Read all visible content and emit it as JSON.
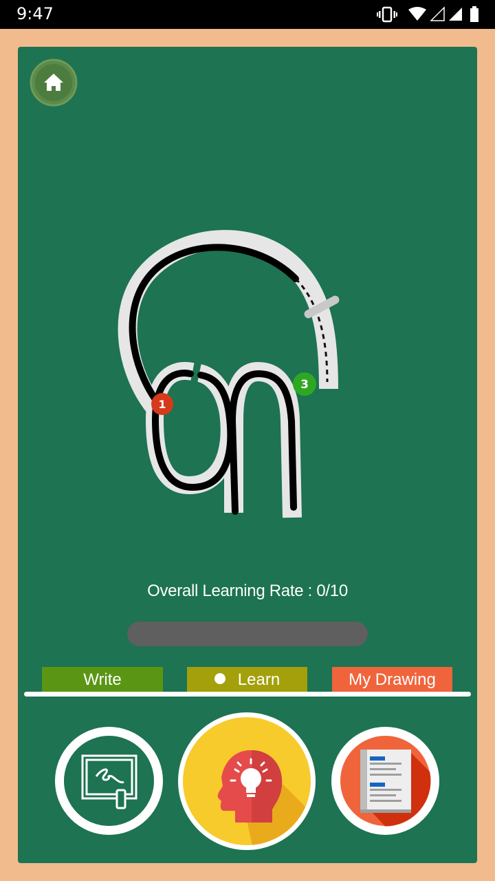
{
  "status_bar": {
    "time": "9:47"
  },
  "home_button": {
    "icon": "home-icon"
  },
  "tracing": {
    "start_marker": "1",
    "marker_3": "3"
  },
  "learning_rate": {
    "text": "Overall Learning Rate : 0/10",
    "value": 0,
    "max": 10
  },
  "tabs": {
    "write_label": "Write",
    "learn_label": "Learn",
    "drawing_label": "My Drawing",
    "selected": "learn"
  },
  "buttons": {
    "write_icon": "whiteboard-icon",
    "learn_icon": "head-lightbulb-icon",
    "drawing_icon": "notebook-icon"
  },
  "colors": {
    "board": "#1d7352",
    "background": "#f2bb8e",
    "write_tab": "#5a9614",
    "learn_tab": "#a3a00c",
    "drawing_tab": "#f0643c",
    "progress_track": "#5f5f5f"
  }
}
